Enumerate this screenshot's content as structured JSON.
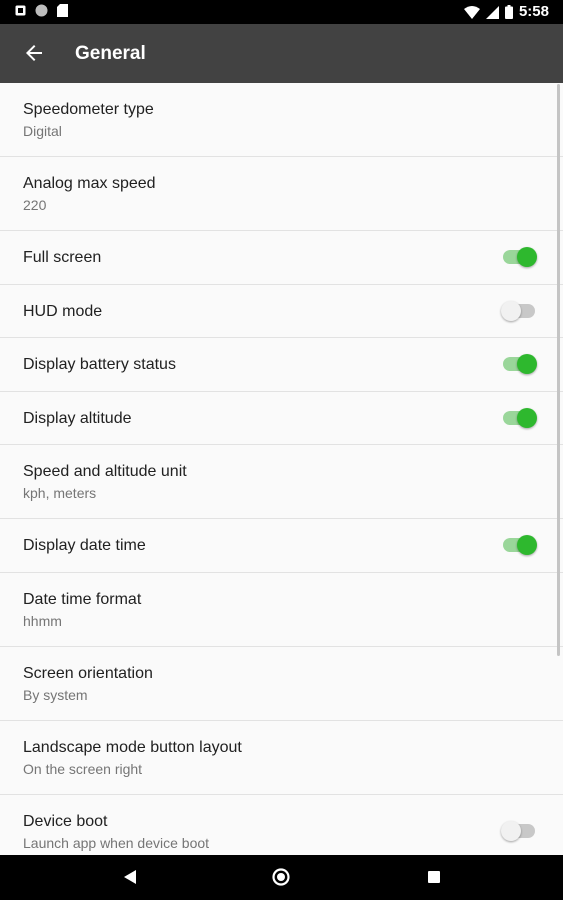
{
  "status_bar": {
    "time": "5:58",
    "left_icons": [
      "notification-square-icon",
      "notification-circle-icon",
      "sim-card-icon"
    ],
    "right_icons": [
      "wifi-icon",
      "signal-icon",
      "battery-icon"
    ]
  },
  "app_bar": {
    "title": "General",
    "back_icon": "arrow-back-icon"
  },
  "settings": [
    {
      "title": "Speedometer type",
      "summary": "Digital"
    },
    {
      "title": "Analog max speed",
      "summary": "220"
    },
    {
      "title": "Full screen",
      "switch": true
    },
    {
      "title": "HUD mode",
      "switch": false
    },
    {
      "title": "Display battery status",
      "switch": true
    },
    {
      "title": "Display altitude",
      "switch": true
    },
    {
      "title": "Speed and altitude unit",
      "summary": "kph, meters"
    },
    {
      "title": "Display date time",
      "switch": true
    },
    {
      "title": "Date time format",
      "summary": "hhmm"
    },
    {
      "title": "Screen orientation",
      "summary": "By system"
    },
    {
      "title": "Landscape mode button layout",
      "summary": "On the screen right"
    },
    {
      "title": "Device boot",
      "summary": "Launch app when device boot",
      "switch": false
    }
  ],
  "nav_bar": {
    "icons": [
      "nav-back-icon",
      "nav-home-icon",
      "nav-recents-icon"
    ]
  },
  "colors": {
    "app_bar": "#424242",
    "switch_on": "#2eb82e",
    "switch_on_track": "#9ad69a",
    "switch_off_track": "#c8c8c8"
  }
}
